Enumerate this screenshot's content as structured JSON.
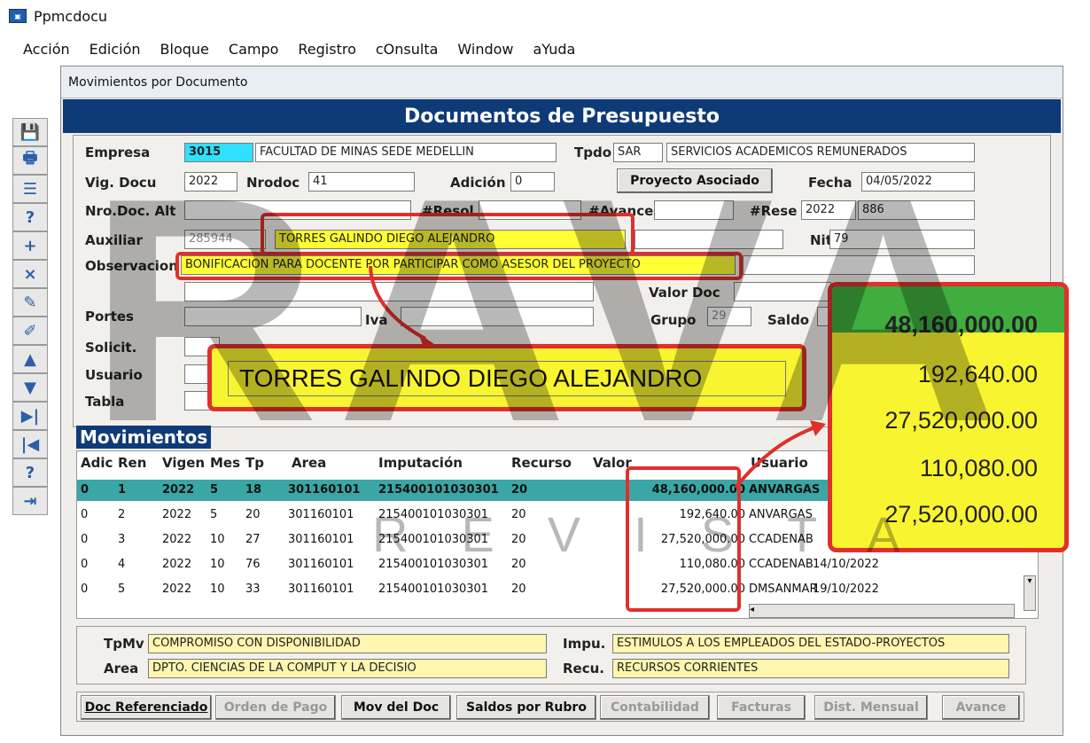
{
  "app": {
    "title": "Ppmcdocu"
  },
  "menu": [
    "Acción",
    "Edición",
    "Bloque",
    "Campo",
    "Registro",
    "cOnsulta",
    "Window",
    "aYuda"
  ],
  "window": {
    "title": "Movimientos por Documento",
    "banner": "Documentos de Presupuesto"
  },
  "header": {
    "empresa_label": "Empresa",
    "empresa_code": "3015",
    "empresa_name": "FACULTAD DE MINAS SEDE MEDELLIN",
    "tpdo_label": "Tpdo",
    "tpdo_code": "SAR",
    "tpdo_name": "SERVICIOS ACADEMICOS REMUNERADOS",
    "vig_label": "Vig. Docu",
    "vig_value": "2022",
    "nrodoc_label": "Nrodoc",
    "nrodoc_value": "41",
    "adicion_label": "Adición",
    "adicion_value": "0",
    "proyecto_button": "Proyecto Asociado",
    "fecha_label": "Fecha",
    "fecha_value": "04/05/2022",
    "nrodocalt_label": "Nro.Doc. Alt",
    "resol_label": "#Resol",
    "avance_label": "#Avance",
    "rese_label": "#Rese",
    "rese_year": "2022",
    "rese_num": "886",
    "auxiliar_label": "Auxiliar",
    "auxiliar_code": "285944",
    "auxiliar_name": "TORRES GALINDO DIEGO ALEJANDRO",
    "nit_label": "Nit",
    "nit_value": "79",
    "obs_label": "Observacion",
    "obs_value": "BONIFICACION PARA DOCENTE POR PARTICIPAR COMO ASESOR DEL PROYECTO",
    "valordoc_label": "Valor Doc",
    "portes_label": "Portes",
    "iva_label": "Iva",
    "grupo_label": "Grupo",
    "grupo_value": "29",
    "saldo_label": "Saldo",
    "solicit_label": "Solicit.",
    "usuario_label": "Usuario",
    "tabla_label": "Tabla",
    "zoom_name": "TORRES GALINDO DIEGO ALEJANDRO"
  },
  "movimientos": {
    "title": "Movimientos",
    "columns": [
      "Adic",
      "Ren",
      "Vigen",
      "Mes",
      "Tp",
      "Area",
      "Imputación",
      "Recurso",
      "Valor",
      "Usuario"
    ],
    "rows": [
      {
        "adic": "0",
        "ren": "1",
        "vigen": "2022",
        "mes": "5",
        "tp": "18",
        "area": "301160101",
        "imp": "215400101030301",
        "rec": "20",
        "valor": "48,160,000.00",
        "usuario": "ANVARGAS",
        "fecha": ""
      },
      {
        "adic": "0",
        "ren": "2",
        "vigen": "2022",
        "mes": "5",
        "tp": "20",
        "area": "301160101",
        "imp": "215400101030301",
        "rec": "20",
        "valor": "192,640.00",
        "usuario": "ANVARGAS",
        "fecha": ""
      },
      {
        "adic": "0",
        "ren": "3",
        "vigen": "2022",
        "mes": "10",
        "tp": "27",
        "area": "301160101",
        "imp": "215400101030301",
        "rec": "20",
        "valor": "27,520,000.00",
        "usuario": "CCADENAB",
        "fecha": ""
      },
      {
        "adic": "0",
        "ren": "4",
        "vigen": "2022",
        "mes": "10",
        "tp": "76",
        "area": "301160101",
        "imp": "215400101030301",
        "rec": "20",
        "valor": "110,080.00",
        "usuario": "CCADENAB",
        "fecha": "14/10/2022"
      },
      {
        "adic": "0",
        "ren": "5",
        "vigen": "2022",
        "mes": "10",
        "tp": "33",
        "area": "301160101",
        "imp": "215400101030301",
        "rec": "20",
        "valor": "27,520,000.00",
        "usuario": "DMSANMAR",
        "fecha": "19/10/2022"
      }
    ]
  },
  "zoom_values": [
    "48,160,000.00",
    "192,640.00",
    "27,520,000.00",
    "110,080.00",
    "27,520,000.00"
  ],
  "detail": {
    "tpmv_label": "TpMv",
    "tpmv_value": "COMPROMISO CON DISPONIBILIDAD",
    "area_label": "Area",
    "area_value": "DPTO. CIENCIAS DE LA COMPUT Y LA DECISIO",
    "impu_label": "Impu.",
    "impu_value": "ESTIMULOS A LOS EMPLEADOS DEL ESTADO-PROYECTOS",
    "recu_label": "Recu.",
    "recu_value": "RECURSOS CORRIENTES"
  },
  "buttons": [
    "Doc Referenciado",
    "Orden de Pago",
    "Mov del Doc",
    "Saldos por Rubro",
    "Contabilidad",
    "Facturas",
    "Dist. Mensual",
    "Avance"
  ],
  "watermark": {
    "big": "RAVA",
    "small": "REVISTA"
  }
}
